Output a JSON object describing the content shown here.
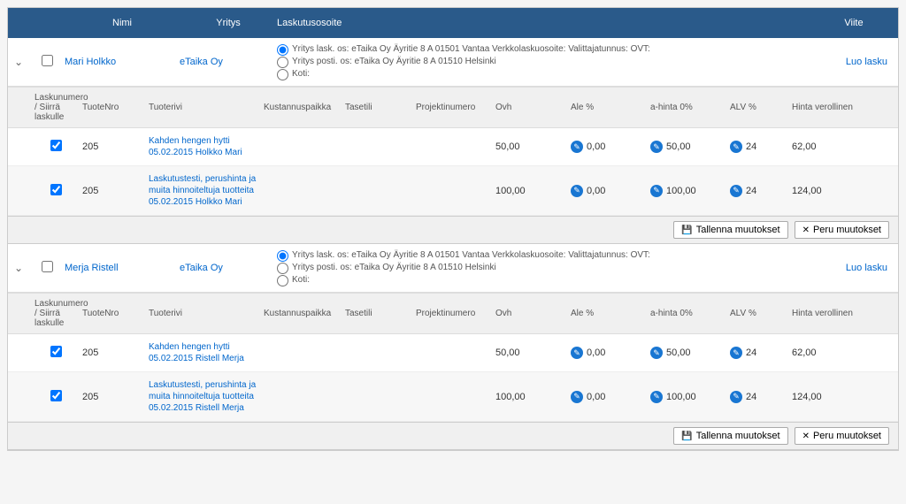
{
  "header": {
    "name": "Nimi",
    "company": "Yritys",
    "address": "Laskutusosoite",
    "reference": "Viite"
  },
  "address_options": {
    "opt1": "Yritys lask. os: eTaika Oy Äyritie 8 A 01501 Vantaa Verkkolaskuosoite: Valittajatunnus: OVT:",
    "opt2": "Yritys posti. os: eTaika Oy Äyritie 8 A 01510 Helsinki",
    "opt3": "Koti:"
  },
  "subheader": {
    "invoice": "Laskunumero / Siirrä laskulle",
    "productno": "TuoteNro",
    "productline": "Tuoterivi",
    "costcenter": "Kustannuspaikka",
    "account": "Tasetili",
    "projectno": "Projektinumero",
    "ovh": "Ovh",
    "ale": "Ale %",
    "ahinta": "a-hinta 0%",
    "alv": "ALV %",
    "price": "Hinta verollinen"
  },
  "create_invoice": "Luo lasku",
  "buttons": {
    "save": "Tallenna muutokset",
    "cancel": "Peru muutokset"
  },
  "customers": [
    {
      "name": "Mari Holkko",
      "company": "eTaika Oy",
      "lines": [
        {
          "nro": "205",
          "desc": "Kahden hengen hytti 05.02.2015 Holkko Mari",
          "ovh": "50,00",
          "ale": "0,00",
          "ahinta": "50,00",
          "alv": "24",
          "price": "62,00"
        },
        {
          "nro": "205",
          "desc": "Laskutustesti, perushinta ja muita hinnoiteltuja tuotteita 05.02.2015 Holkko Mari",
          "ovh": "100,00",
          "ale": "0,00",
          "ahinta": "100,00",
          "alv": "24",
          "price": "124,00"
        }
      ]
    },
    {
      "name": "Merja Ristell",
      "company": "eTaika Oy",
      "lines": [
        {
          "nro": "205",
          "desc": "Kahden hengen hytti 05.02.2015 Ristell Merja",
          "ovh": "50,00",
          "ale": "0,00",
          "ahinta": "50,00",
          "alv": "24",
          "price": "62,00"
        },
        {
          "nro": "205",
          "desc": "Laskutustesti, perushinta ja muita hinnoiteltuja tuotteita 05.02.2015 Ristell Merja",
          "ovh": "100,00",
          "ale": "0,00",
          "ahinta": "100,00",
          "alv": "24",
          "price": "124,00"
        }
      ]
    }
  ]
}
